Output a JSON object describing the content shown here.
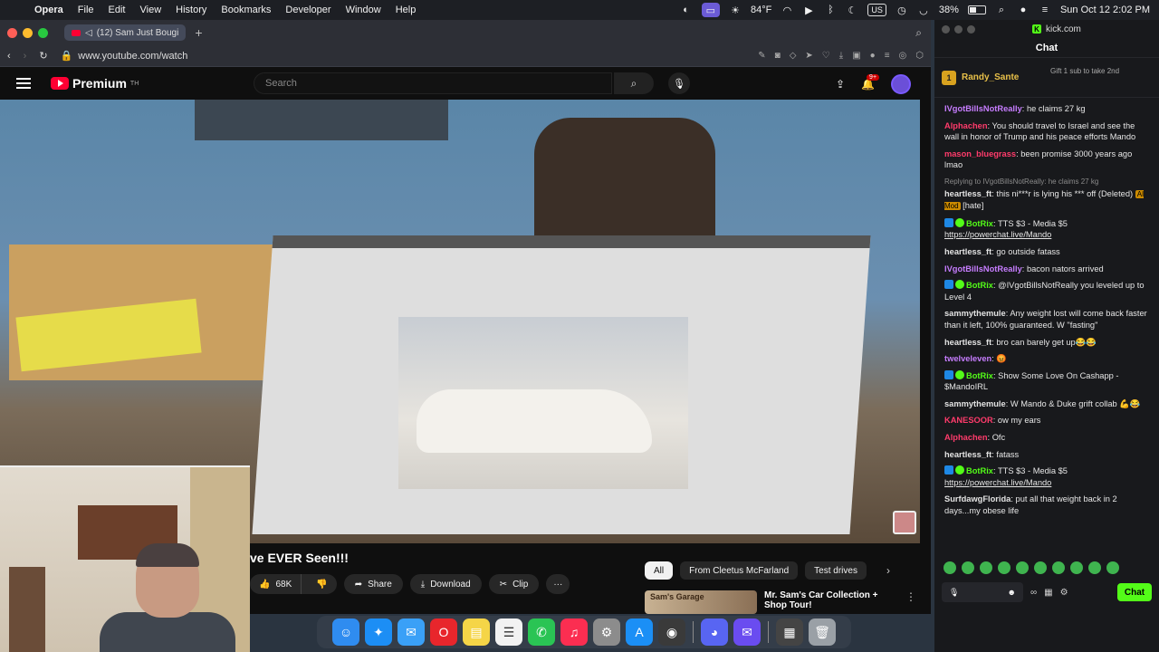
{
  "menubar": {
    "app_name": "Opera",
    "items": [
      "File",
      "Edit",
      "View",
      "History",
      "Bookmarks",
      "Developer",
      "Window",
      "Help"
    ],
    "temperature": "84°F",
    "keyboard": "US",
    "battery": "38%",
    "datetime": "Sun Oct 12  2:02 PM"
  },
  "browser": {
    "tab_title": "(12) Sam Just Bougi",
    "url": "www.youtube.com/watch"
  },
  "youtube": {
    "logo_text": "Premium",
    "logo_sup": "TH",
    "search_placeholder": "Search",
    "notif_badge": "9+",
    "video_title": "ve EVER Seen!!!",
    "likes": "68K",
    "share_label": "Share",
    "download_label": "Download",
    "clip_label": "Clip",
    "more_label": "···",
    "chips": [
      "All",
      "From Cleetus McFarland",
      "Test drives"
    ],
    "rec_thumb_text": "Sam's Garage",
    "rec_title": "Mr. Sam's Car Collection + Shop Tour!"
  },
  "kick": {
    "app_title": "kick.com",
    "chat_header": "Chat",
    "pinned_rank": "1",
    "pinned_user": "Randy_Sante",
    "pinned_gift": "Gift 1 sub to take 2nd",
    "messages": [
      {
        "user": "IVgotBillsNotReally",
        "color": "#c77dff",
        "text": "he claims 27 kg"
      },
      {
        "user": "Alphachen",
        "color": "#ff3b6b",
        "text": "You should travel to Israel and see the wall in honor of Trump and his peace efforts Mando"
      },
      {
        "user": "mason_bluegrass",
        "color": "#ff3b6b",
        "text": "been promise 3000 years ago lmao"
      },
      {
        "user": "heartless_ft",
        "color": "#e3e3e3",
        "reply": "Replying to IVgotBillsNotReally: he claims 27 kg",
        "text": "this ni***r is lying his *** off (Deleted)",
        "mod": "AI Mod",
        "mod_tag": "[hate]"
      },
      {
        "user": "BotRix",
        "color": "#53fc18",
        "text": "TTS $3 - Media $5",
        "link": "https://powerchat.live/Mando"
      },
      {
        "user": "heartless_ft",
        "color": "#e3e3e3",
        "text": "go outside fatass"
      },
      {
        "user": "IVgotBillsNotReally",
        "color": "#c77dff",
        "text": "bacon nators arrived"
      },
      {
        "user": "BotRix",
        "color": "#53fc18",
        "text": "@IVgotBillsNotReally you leveled up to Level 4"
      },
      {
        "user": "sammythemule",
        "color": "#e3e3e3",
        "text": "Any weight lost will come back faster than it left, 100% guaranteed. W \"fasting\""
      },
      {
        "user": "heartless_ft",
        "color": "#e3e3e3",
        "text": "bro can barely get up😂😂"
      },
      {
        "user": "twelveleven",
        "color": "#c77dff",
        "text": "😡"
      },
      {
        "user": "BotRix",
        "color": "#53fc18",
        "text": "Show Some Love On Cashapp - $MandoIRL"
      },
      {
        "user": "sammythemule",
        "color": "#e3e3e3",
        "text": "W Mando & Duke grift collab 💪😂"
      },
      {
        "user": "KANESOOR",
        "color": "#ff3b6b",
        "text": "ow my ears"
      },
      {
        "user": "Alphachen",
        "color": "#ff3b6b",
        "text": "Ofc"
      },
      {
        "user": "heartless_ft",
        "color": "#e3e3e3",
        "text": "fatass"
      },
      {
        "user": "BotRix",
        "color": "#53fc18",
        "text": "TTS $3 - Media $5",
        "link": "https://powerchat.live/Mando"
      },
      {
        "user": "SurfdawgFlorida",
        "color": "#e3e3e3",
        "text": "put all that weight back in 2 days...my obese life"
      }
    ],
    "send_label": "Chat"
  }
}
